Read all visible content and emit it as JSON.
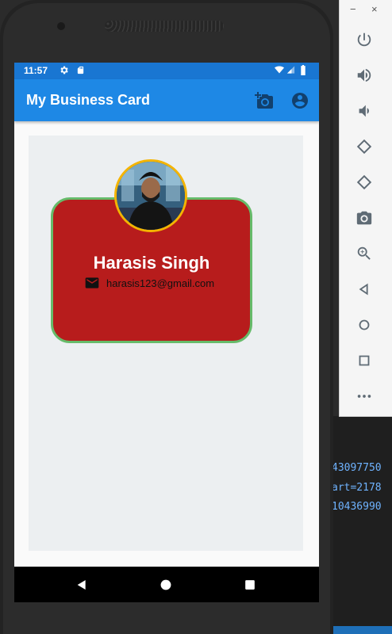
{
  "status_bar": {
    "time": "11:57"
  },
  "app_bar": {
    "title": "My Business Card"
  },
  "card": {
    "name": "Harasis Singh",
    "email": "harasis123@gmail.com"
  },
  "emulator": {
    "window_controls": [
      "−",
      "×"
    ]
  },
  "ide_console": {
    "lines": [
      "43097750",
      "art=2178",
      "10436990"
    ]
  },
  "colors": {
    "app_bar": "#1e88e5",
    "status_bar": "#1976d2",
    "card": "#b71c1c",
    "card_border": "#66bb6a",
    "avatar_ring": "#f4b400",
    "background": "#eceff1"
  }
}
